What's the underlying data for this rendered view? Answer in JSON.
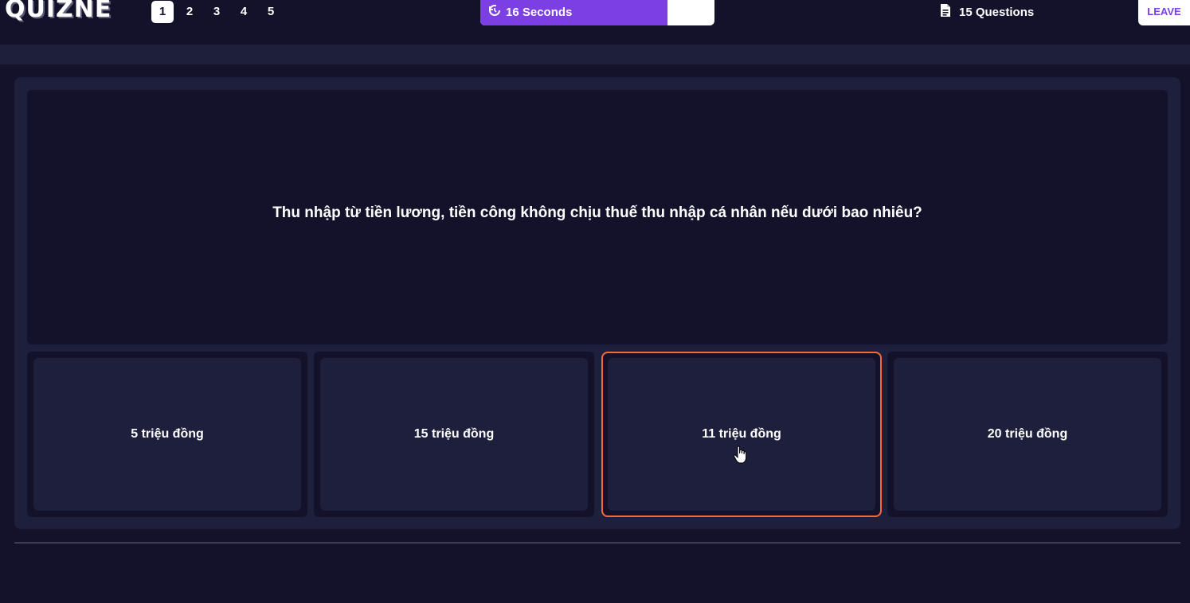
{
  "header": {
    "logo_text": "QUIZNE",
    "pages": [
      "1",
      "2",
      "3",
      "4",
      "5"
    ],
    "active_page": "1",
    "timer_label": "16 Seconds",
    "timer_fraction": 0.8,
    "questions_label": "15 Questions",
    "leave_label": "LEAVE"
  },
  "question": {
    "text": "Thu nhập từ tiền lương, tiền công không chịu thuế thu nhập cá nhân nếu dưới bao nhiêu?"
  },
  "options": [
    {
      "label": "5 triệu đồng",
      "selected": false
    },
    {
      "label": "15 triệu đồng",
      "selected": false
    },
    {
      "label": "11 triệu đồng",
      "selected": true
    },
    {
      "label": "20 triệu đồng",
      "selected": false
    }
  ],
  "colors": {
    "accent": "#7b3fe4",
    "selected_border": "#f36b3a",
    "background": "#13122a",
    "card": "#1e1f3d"
  },
  "icons": {
    "timer": "timer-reset-icon",
    "questions": "document-icon",
    "cursor": "hand-pointer-icon"
  }
}
